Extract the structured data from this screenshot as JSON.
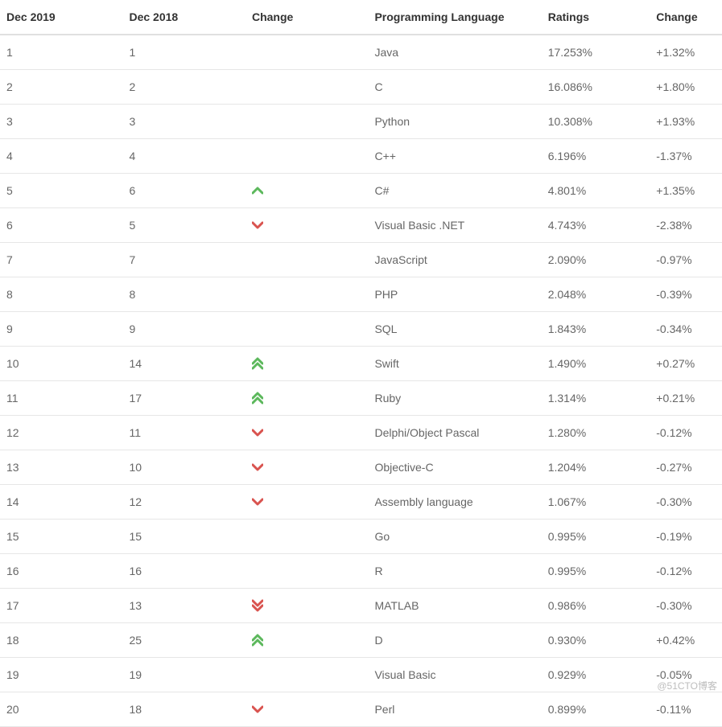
{
  "headers": {
    "rank2019": "Dec 2019",
    "rank2018": "Dec 2018",
    "arrow": "Change",
    "language": "Programming Language",
    "ratings": "Ratings",
    "change": "Change"
  },
  "arrowColors": {
    "up": "#5cb85c",
    "down": "#d9534f"
  },
  "rows": [
    {
      "rank2019": "1",
      "rank2018": "1",
      "arrow": "none",
      "language": "Java",
      "ratings": "17.253%",
      "change": "+1.32%"
    },
    {
      "rank2019": "2",
      "rank2018": "2",
      "arrow": "none",
      "language": "C",
      "ratings": "16.086%",
      "change": "+1.80%"
    },
    {
      "rank2019": "3",
      "rank2018": "3",
      "arrow": "none",
      "language": "Python",
      "ratings": "10.308%",
      "change": "+1.93%"
    },
    {
      "rank2019": "4",
      "rank2018": "4",
      "arrow": "none",
      "language": "C++",
      "ratings": "6.196%",
      "change": "-1.37%"
    },
    {
      "rank2019": "5",
      "rank2018": "6",
      "arrow": "up",
      "language": "C#",
      "ratings": "4.801%",
      "change": "+1.35%"
    },
    {
      "rank2019": "6",
      "rank2018": "5",
      "arrow": "down",
      "language": "Visual Basic .NET",
      "ratings": "4.743%",
      "change": "-2.38%"
    },
    {
      "rank2019": "7",
      "rank2018": "7",
      "arrow": "none",
      "language": "JavaScript",
      "ratings": "2.090%",
      "change": "-0.97%"
    },
    {
      "rank2019": "8",
      "rank2018": "8",
      "arrow": "none",
      "language": "PHP",
      "ratings": "2.048%",
      "change": "-0.39%"
    },
    {
      "rank2019": "9",
      "rank2018": "9",
      "arrow": "none",
      "language": "SQL",
      "ratings": "1.843%",
      "change": "-0.34%"
    },
    {
      "rank2019": "10",
      "rank2018": "14",
      "arrow": "doubleUp",
      "language": "Swift",
      "ratings": "1.490%",
      "change": "+0.27%"
    },
    {
      "rank2019": "11",
      "rank2018": "17",
      "arrow": "doubleUp",
      "language": "Ruby",
      "ratings": "1.314%",
      "change": "+0.21%"
    },
    {
      "rank2019": "12",
      "rank2018": "11",
      "arrow": "down",
      "language": "Delphi/Object Pascal",
      "ratings": "1.280%",
      "change": "-0.12%"
    },
    {
      "rank2019": "13",
      "rank2018": "10",
      "arrow": "down",
      "language": "Objective-C",
      "ratings": "1.204%",
      "change": "-0.27%"
    },
    {
      "rank2019": "14",
      "rank2018": "12",
      "arrow": "down",
      "language": "Assembly language",
      "ratings": "1.067%",
      "change": "-0.30%"
    },
    {
      "rank2019": "15",
      "rank2018": "15",
      "arrow": "none",
      "language": "Go",
      "ratings": "0.995%",
      "change": "-0.19%"
    },
    {
      "rank2019": "16",
      "rank2018": "16",
      "arrow": "none",
      "language": "R",
      "ratings": "0.995%",
      "change": "-0.12%"
    },
    {
      "rank2019": "17",
      "rank2018": "13",
      "arrow": "doubleDown",
      "language": "MATLAB",
      "ratings": "0.986%",
      "change": "-0.30%"
    },
    {
      "rank2019": "18",
      "rank2018": "25",
      "arrow": "doubleUp",
      "language": "D",
      "ratings": "0.930%",
      "change": "+0.42%"
    },
    {
      "rank2019": "19",
      "rank2018": "19",
      "arrow": "none",
      "language": "Visual Basic",
      "ratings": "0.929%",
      "change": "-0.05%"
    },
    {
      "rank2019": "20",
      "rank2018": "18",
      "arrow": "down",
      "language": "Perl",
      "ratings": "0.899%",
      "change": "-0.11%"
    }
  ],
  "watermark": "@51CTO博客",
  "chart_data": {
    "type": "table",
    "title": "TIOBE Index — Dec 2019 vs Dec 2018",
    "columns": [
      "Dec 2019",
      "Dec 2018",
      "Change (direction)",
      "Programming Language",
      "Ratings",
      "Change"
    ],
    "rows": [
      [
        1,
        1,
        "same",
        "Java",
        "17.253%",
        "+1.32%"
      ],
      [
        2,
        2,
        "same",
        "C",
        "16.086%",
        "+1.80%"
      ],
      [
        3,
        3,
        "same",
        "Python",
        "10.308%",
        "+1.93%"
      ],
      [
        4,
        4,
        "same",
        "C++",
        "6.196%",
        "-1.37%"
      ],
      [
        5,
        6,
        "up",
        "C#",
        "4.801%",
        "+1.35%"
      ],
      [
        6,
        5,
        "down",
        "Visual Basic .NET",
        "4.743%",
        "-2.38%"
      ],
      [
        7,
        7,
        "same",
        "JavaScript",
        "2.090%",
        "-0.97%"
      ],
      [
        8,
        8,
        "same",
        "PHP",
        "2.048%",
        "-0.39%"
      ],
      [
        9,
        9,
        "same",
        "SQL",
        "1.843%",
        "-0.34%"
      ],
      [
        10,
        14,
        "up-big",
        "Swift",
        "1.490%",
        "+0.27%"
      ],
      [
        11,
        17,
        "up-big",
        "Ruby",
        "1.314%",
        "+0.21%"
      ],
      [
        12,
        11,
        "down",
        "Delphi/Object Pascal",
        "1.280%",
        "-0.12%"
      ],
      [
        13,
        10,
        "down",
        "Objective-C",
        "1.204%",
        "-0.27%"
      ],
      [
        14,
        12,
        "down",
        "Assembly language",
        "1.067%",
        "-0.30%"
      ],
      [
        15,
        15,
        "same",
        "Go",
        "0.995%",
        "-0.19%"
      ],
      [
        16,
        16,
        "same",
        "R",
        "0.995%",
        "-0.12%"
      ],
      [
        17,
        13,
        "down-big",
        "MATLAB",
        "0.986%",
        "-0.30%"
      ],
      [
        18,
        25,
        "up-big",
        "D",
        "0.930%",
        "+0.42%"
      ],
      [
        19,
        19,
        "same",
        "Visual Basic",
        "0.929%",
        "-0.05%"
      ],
      [
        20,
        18,
        "down",
        "Perl",
        "0.899%",
        "-0.11%"
      ]
    ]
  }
}
